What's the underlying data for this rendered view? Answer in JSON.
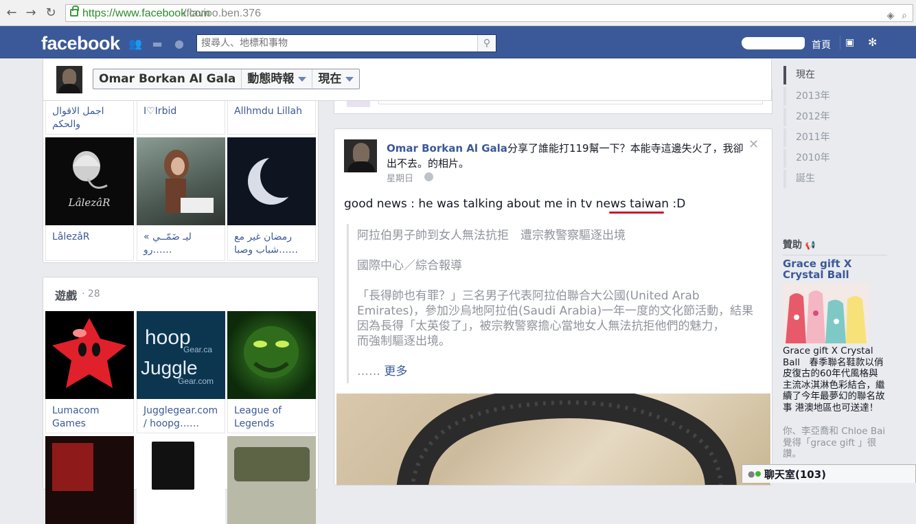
{
  "browser": {
    "url_scheme_host": "https://www.facebook.com",
    "url_path": "/flavioo.ben.376"
  },
  "fb": {
    "logo": "facebook",
    "search_placeholder": "搜尋人、地標和事物",
    "home": "首頁"
  },
  "sticky": {
    "name": "Omar Borkan Al Gala",
    "timeline": "動態時報",
    "now": "現在"
  },
  "likes_grid": {
    "captions_top": [
      "اجمل الاقوال والحكم",
      "I♡Irbid",
      "Allhmdu Lillah"
    ],
    "tile_texts": [
      "LâlezâR"
    ],
    "captions_bottom": [
      "LâlezâR",
      "ليـ ضَمّــي » رو……",
      "رمضان غير مع شباب وصبا……"
    ]
  },
  "games": {
    "title": "遊戲",
    "count": "· 28",
    "logo_hoop": "hoop",
    "logo_gearca": "Gear.ca",
    "logo_juggle": "Juggle",
    "logo_gearcom": "Gear.com",
    "items": [
      "Lumacom Games",
      "Jugglegear.com / hoopg……",
      "League of Legends"
    ]
  },
  "post": {
    "author": "Omar Borkan Al Gala",
    "action": "分享了誰能打119幫一下？本能寺這邊失火了，我卻出不去。的相片。",
    "time": "星期日",
    "text": "good news : he was talking about me in tv news taiwan :D",
    "quote_lines": [
      "阿拉伯男子帥到女人無法抗拒　遭宗教警察驅逐出境",
      "國際中心／綜合報導",
      "「長得帥也有罪？」三名男子代表阿拉伯聯合大公國(United Arab",
      "Emirates)，參加沙烏地阿拉伯(Saudi Arabia)一年一度的文化節活動，結果",
      "因為長得「太英俊了」，被宗教警察擔心當地女人無法抗拒他們的魅力，",
      "而強制驅逐出境。"
    ],
    "more_prefix": "……",
    "more": "更多"
  },
  "timeline": {
    "years": [
      "現在",
      "2013年",
      "2012年",
      "2011年",
      "2010年",
      "誕生"
    ]
  },
  "sponsored": {
    "heading": "贊助",
    "ad_title": "Grace gift X Crystal Ball",
    "ad_body": "Grace gift X Crystal Ball　春季聯名鞋款以俏皮復古的60年代風格與主流冰淇淋色彩結合，繼續了今年最夢幻的聯名故事 港澳地區也可送達！",
    "ad_social": "你、李亞喬和 Chloe Bai 覺得「grace gift 」很讚。"
  },
  "chat": {
    "label": "聊天室(103)"
  }
}
